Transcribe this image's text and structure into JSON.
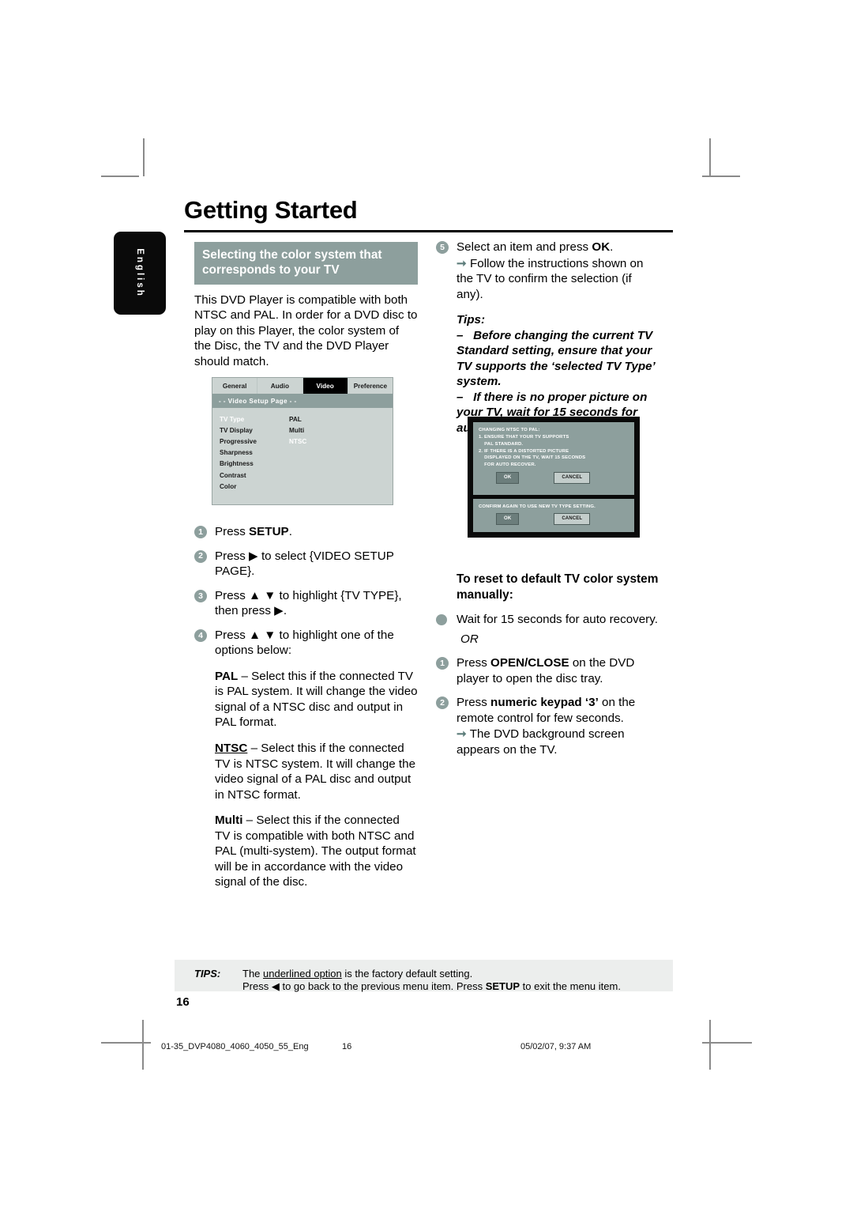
{
  "page": {
    "title": "Getting Started",
    "language_tab": "English",
    "page_number": "16"
  },
  "left_column": {
    "section_heading": "Selecting the color system that corresponds to your TV",
    "intro": "This DVD Player is compatible with both NTSC and PAL. In order for a DVD disc to play on this Player, the color system of the Disc, the TV and the DVD Player should match.",
    "steps": [
      {
        "num": "1",
        "text_html": "Press <b>SETUP</b>."
      },
      {
        "num": "2",
        "text_html": "Press ▶ to select {VIDEO SETUP PAGE}."
      },
      {
        "num": "3",
        "text_html": "Press ▲ ▼ to highlight {TV TYPE}, then press ▶."
      },
      {
        "num": "4",
        "text_html": "Press ▲ ▼ to highlight one of the options below:"
      }
    ],
    "options": [
      {
        "name": "PAL",
        "underlined": false,
        "text": " – Select this if the connected TV is PAL system. It will change the video signal of a NTSC disc and output in PAL format."
      },
      {
        "name": "NTSC",
        "underlined": true,
        "text": " – Select this if the connected TV is NTSC system. It will change the video signal of a PAL disc and output in NTSC format."
      },
      {
        "name": "Multi",
        "underlined": false,
        "text": " – Select this if the connected TV is compatible with both NTSC and PAL (multi-system). The output format will be in accordance with the video signal of the disc."
      }
    ]
  },
  "setup_menu": {
    "tabs": [
      {
        "label": "General",
        "active": false
      },
      {
        "label": "Audio",
        "active": false
      },
      {
        "label": "Video",
        "active": true
      },
      {
        "label": "Preference",
        "active": false
      }
    ],
    "subbar": "- -  Video Setup Page  - -",
    "items": [
      {
        "label": "TV Type",
        "highlighted": true
      },
      {
        "label": "TV Display",
        "highlighted": false
      },
      {
        "label": "Progressive",
        "highlighted": false
      },
      {
        "label": "Sharpness",
        "highlighted": false
      },
      {
        "label": "Brightness",
        "highlighted": false
      },
      {
        "label": "Contrast",
        "highlighted": false
      },
      {
        "label": "Color",
        "highlighted": false
      }
    ],
    "values": [
      {
        "label": "PAL",
        "highlighted": false
      },
      {
        "label": "Multi",
        "highlighted": false
      },
      {
        "label": "NTSC",
        "highlighted": true
      }
    ]
  },
  "right_column": {
    "step5": {
      "num": "5",
      "text_html": "Select an item and press <b>OK</b>."
    },
    "step5_arrow": "Follow the instructions shown on the TV to confirm the selection (if any).",
    "tips_label": "Tips:",
    "tips": [
      "Before changing the current TV Standard setting, ensure that your TV supports the ‘selected TV Type’ system.",
      "If there is no proper picture on your TV, wait for 15 seconds for auto recovery."
    ],
    "reset_heading": "To reset to default TV color system manually:",
    "reset_bullet": "Wait for 15 seconds for auto recovery.",
    "or_label": "OR",
    "reset_steps": [
      {
        "num": "1",
        "text_html": "Press <b>OPEN/CLOSE</b> on the DVD player to open the disc tray."
      },
      {
        "num": "2",
        "text_html": "Press <b>numeric keypad ‘3’</b> on the remote control for few seconds."
      }
    ],
    "reset_arrow": "The DVD background screen appears on the TV."
  },
  "tv_warning": {
    "panel1": {
      "lines": [
        "CHANGING NTSC TO PAL:",
        "1. ENSURE THAT YOUR TV SUPPORTS",
        "    PAL STANDARD.",
        "2. IF THERE IS A DISTORTED PICTURE",
        "    DISPLAYED ON THE TV, WAIT 15 SECONDS",
        "    FOR AUTO RECOVER."
      ],
      "ok": "OK",
      "cancel": "CANCEL"
    },
    "panel2": {
      "line": "CONFIRM AGAIN TO USE NEW TV TYPE SETTING.",
      "ok": "OK",
      "cancel": "CANCEL"
    }
  },
  "tips_footer": {
    "label": "TIPS:",
    "line1_pre": "The ",
    "line1_underlined": "underlined option",
    "line1_post": " is the factory default setting.",
    "line2_pre": "Press ◀ to go back to the previous menu item. Press ",
    "line2_bold": "SETUP",
    "line2_post": " to exit the menu item."
  },
  "print_footer": {
    "filename": "01-35_DVP4080_4060_4050_55_Eng",
    "page": "16",
    "timestamp": "05/02/07, 9:37 AM"
  },
  "colors": {
    "accent_teal": "#8d9f9d",
    "menu_body": "#ccd4d2",
    "tips_bg": "#eceeed",
    "tab_black": "#0a0a0a"
  }
}
